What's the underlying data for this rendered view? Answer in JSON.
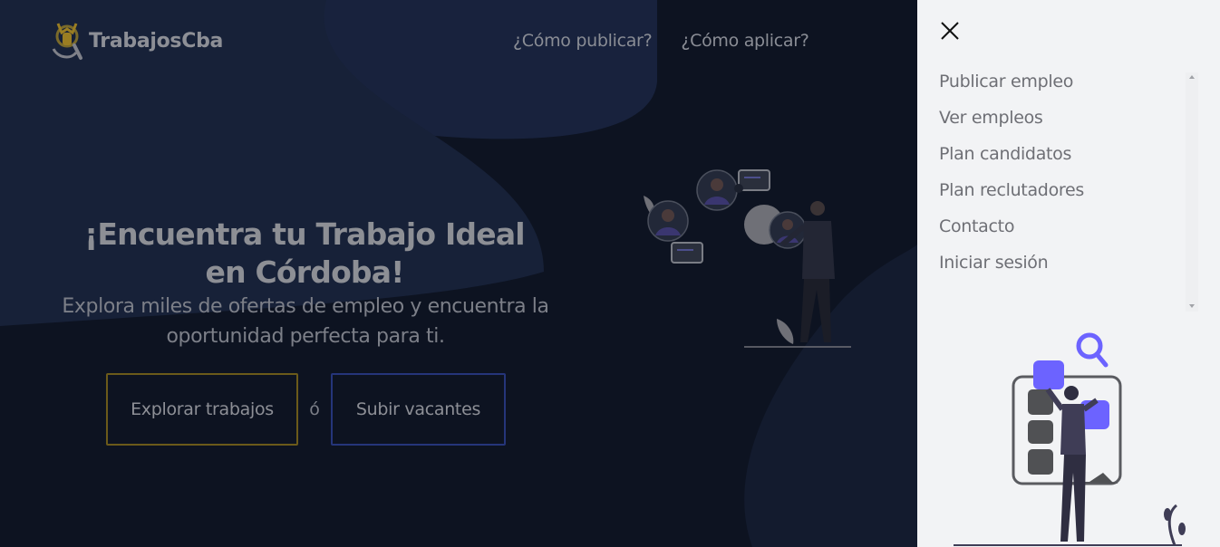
{
  "brand": {
    "name": "TrabajosCba",
    "logo_icon": "person-search-logo"
  },
  "topnav": {
    "how_publish": "¿Cómo publicar?",
    "how_apply": "¿Cómo aplicar?"
  },
  "hero": {
    "title": "¡Encuentra tu Trabajo Ideal en Córdoba!",
    "subtitle": "Explora miles de ofertas de empleo y encuentra la oportunidad perfecta para ti.",
    "explore_button": "Explorar trabajos",
    "or_text": "ó",
    "upload_button": "Subir vacantes"
  },
  "side_menu": {
    "close_icon": "close-icon",
    "items": [
      {
        "label": "Publicar empleo"
      },
      {
        "label": "Ver empleos"
      },
      {
        "label": "Plan candidatos"
      },
      {
        "label": "Plan reclutadores"
      },
      {
        "label": "Contacto"
      },
      {
        "label": "Iniciar sesión"
      }
    ]
  },
  "colors": {
    "hero_bg": "#0d1321",
    "panel_bg": "#f2f3f5",
    "accent_gold": "#b8962a",
    "accent_blue": "#3b55c8",
    "illustration_purple": "#6c63ff"
  }
}
